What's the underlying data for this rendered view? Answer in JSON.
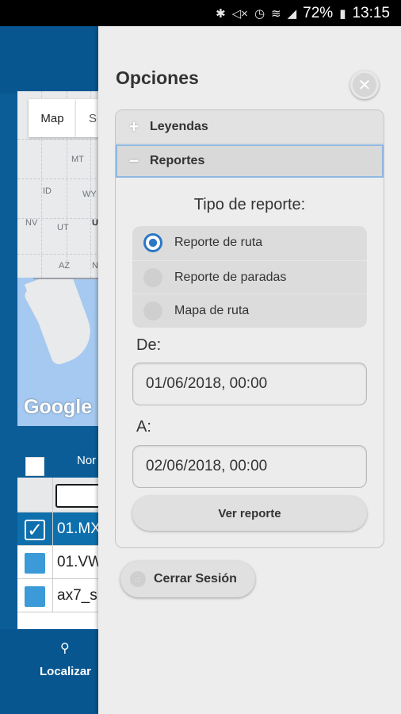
{
  "status_bar": {
    "battery": "72%",
    "time": "13:15",
    "icons": [
      "bluetooth-icon",
      "mute-icon",
      "alarm-icon",
      "wifi-icon",
      "signal-icon",
      "battery-icon"
    ]
  },
  "background_app": {
    "map": {
      "tab_map": "Map",
      "tab_satellite": "S",
      "labels": [
        "MT",
        "ID",
        "WY",
        "NV",
        "UT",
        "U",
        "AZ",
        "N"
      ],
      "attribution": "Google"
    },
    "table": {
      "header_label": "Nor",
      "rows": [
        {
          "text": "01.MX",
          "checked": true
        },
        {
          "text": "01.VW",
          "checked": false
        },
        {
          "text": "ax7_s",
          "checked": false
        }
      ]
    },
    "bottom_nav": {
      "label": "Localizar",
      "icon": "search-icon"
    }
  },
  "panel": {
    "title": "Opciones",
    "close_icon": "close-icon",
    "accordion": {
      "sections": [
        {
          "label": "Leyendas",
          "icon": "plus-icon",
          "expanded": false
        },
        {
          "label": "Reportes",
          "icon": "minus-icon",
          "expanded": true
        }
      ]
    },
    "report": {
      "type_label": "Tipo de reporte:",
      "options": [
        {
          "label": "Reporte de ruta",
          "selected": true
        },
        {
          "label": "Reporte de paradas",
          "selected": false
        },
        {
          "label": "Mapa de ruta",
          "selected": false
        }
      ],
      "from_label": "De:",
      "from_value": "01/06/2018, 00:00",
      "to_label": "A:",
      "to_value": "02/06/2018, 00:00",
      "submit_label": "Ver reporte"
    },
    "logout_label": "Cerrar Sesión",
    "logout_icon": "home-icon"
  },
  "colors": {
    "app_blue": "#0b5d97",
    "radio_accent": "#2a78c6",
    "panel_bg": "#ededed"
  }
}
